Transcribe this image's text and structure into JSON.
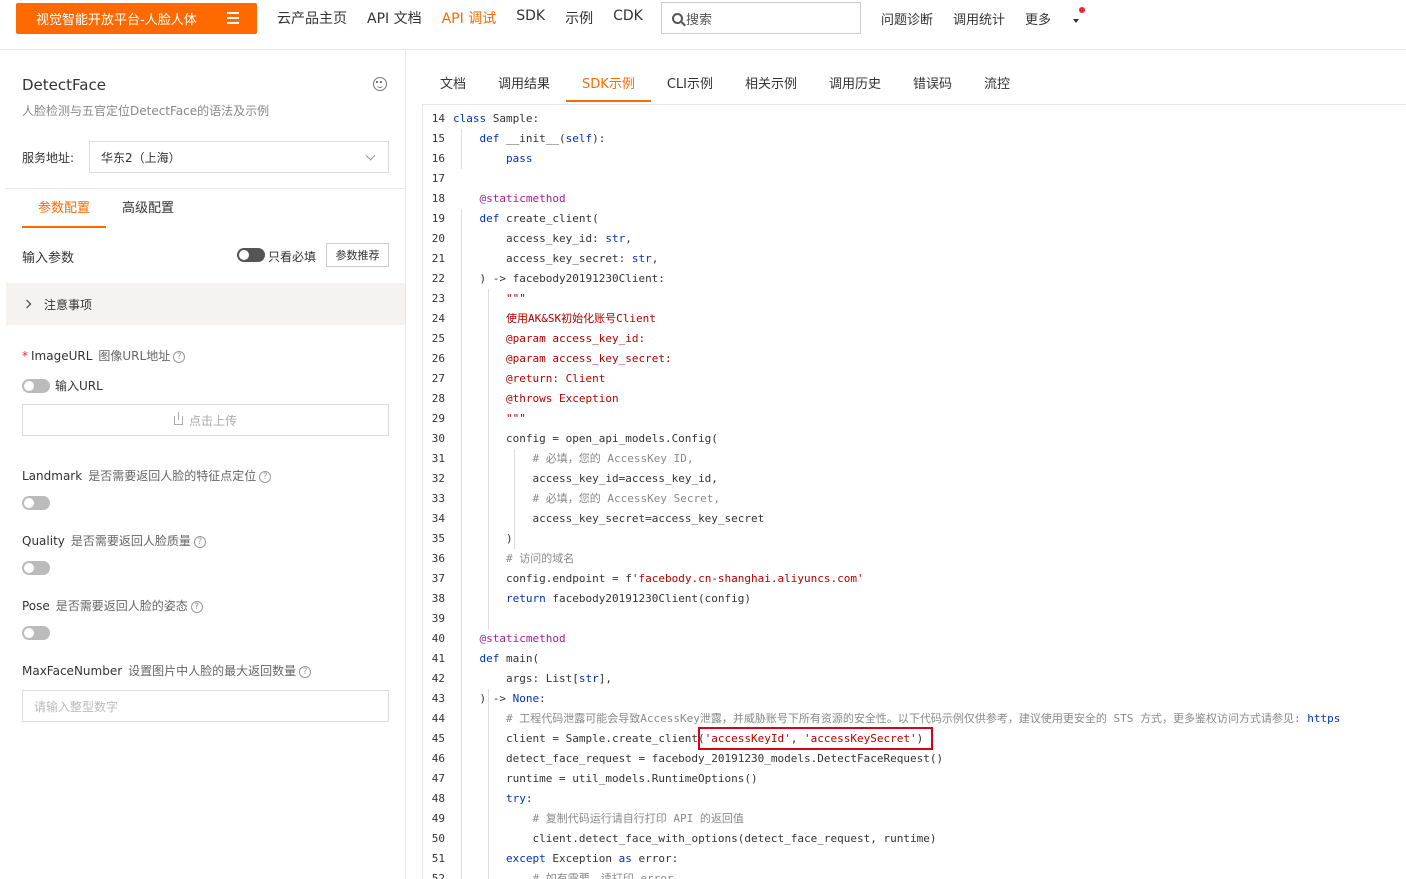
{
  "topbar": {
    "brand": "视觉智能开放平台-人脸人体",
    "nav": [
      "云产品主页",
      "API 文档",
      "API 调试",
      "SDK",
      "示例",
      "CDK"
    ],
    "nav_active": 2,
    "search_placeholder": "搜索",
    "right_links": [
      "问题诊断",
      "调用统计"
    ],
    "more": "更多"
  },
  "left": {
    "api_name": "DetectFace",
    "api_desc": "人脸检测与五官定位DetectFace的语法及示例",
    "service_label": "服务地址:",
    "service_value": "华东2（上海）",
    "tabs": [
      "参数配置",
      "高级配置"
    ],
    "input_params_label": "输入参数",
    "required_only_label": "只看必填",
    "recommend_button": "参数推荐",
    "notice": "注意事项",
    "image_url": {
      "name": "ImageURL",
      "desc": "图像URL地址",
      "toggle_label": "输入URL",
      "upload": "点击上传"
    },
    "landmark": {
      "name": "Landmark",
      "desc": "是否需要返回人脸的特征点定位"
    },
    "quality": {
      "name": "Quality",
      "desc": "是否需要返回人脸质量"
    },
    "pose": {
      "name": "Pose",
      "desc": "是否需要返回人脸的姿态"
    },
    "max_face": {
      "name": "MaxFaceNumber",
      "desc": "设置图片中人脸的最大返回数量",
      "placeholder": "请输入整型数字"
    }
  },
  "right": {
    "tabs": [
      "文档",
      "调用结果",
      "SDK示例",
      "CLI示例",
      "相关示例",
      "调用历史",
      "错误码",
      "流控"
    ],
    "active_tab": 2,
    "code_lines": [
      {
        "n": "14",
        "indent": 0,
        "parts": [
          [
            "kw",
            "class "
          ],
          [
            "txt",
            "Sample:"
          ]
        ]
      },
      {
        "n": "15",
        "indent": 1,
        "parts": [
          [
            "kw",
            "def "
          ],
          [
            "txt",
            "__init__("
          ],
          [
            "kw",
            "self"
          ],
          [
            "txt",
            "):"
          ]
        ]
      },
      {
        "n": "16",
        "indent": 2,
        "parts": [
          [
            "kw",
            "pass"
          ]
        ]
      },
      {
        "n": "17",
        "indent": 0,
        "parts": []
      },
      {
        "n": "18",
        "indent": 1,
        "parts": [
          [
            "dec",
            "@staticmethod"
          ]
        ]
      },
      {
        "n": "19",
        "indent": 1,
        "parts": [
          [
            "kw",
            "def "
          ],
          [
            "txt",
            "create_client("
          ]
        ]
      },
      {
        "n": "20",
        "indent": 2,
        "parts": [
          [
            "txt",
            "access_key_id: "
          ],
          [
            "kw",
            "str"
          ],
          [
            "txt",
            ","
          ]
        ]
      },
      {
        "n": "21",
        "indent": 2,
        "parts": [
          [
            "txt",
            "access_key_secret: "
          ],
          [
            "kw",
            "str"
          ],
          [
            "txt",
            ","
          ]
        ]
      },
      {
        "n": "22",
        "indent": 1,
        "parts": [
          [
            "txt",
            ") -> facebody20191230Client:"
          ]
        ]
      },
      {
        "n": "23",
        "indent": 2,
        "parts": [
          [
            "str",
            "\"\"\""
          ]
        ]
      },
      {
        "n": "24",
        "indent": 2,
        "parts": [
          [
            "str",
            "使用AK&SK初始化账号Client"
          ]
        ]
      },
      {
        "n": "25",
        "indent": 2,
        "parts": [
          [
            "str",
            "@param access_key_id:"
          ]
        ]
      },
      {
        "n": "26",
        "indent": 2,
        "parts": [
          [
            "str",
            "@param access_key_secret:"
          ]
        ]
      },
      {
        "n": "27",
        "indent": 2,
        "parts": [
          [
            "str",
            "@return: Client"
          ]
        ]
      },
      {
        "n": "28",
        "indent": 2,
        "parts": [
          [
            "str",
            "@throws Exception"
          ]
        ]
      },
      {
        "n": "29",
        "indent": 2,
        "parts": [
          [
            "str",
            "\"\"\""
          ]
        ]
      },
      {
        "n": "30",
        "indent": 2,
        "parts": [
          [
            "txt",
            "config = open_api_models.Config("
          ]
        ]
      },
      {
        "n": "31",
        "indent": 3,
        "parts": [
          [
            "cmt",
            "# 必填，您的 AccessKey ID,"
          ]
        ]
      },
      {
        "n": "32",
        "indent": 3,
        "parts": [
          [
            "txt",
            "access_key_id=access_key_id,"
          ]
        ]
      },
      {
        "n": "33",
        "indent": 3,
        "parts": [
          [
            "cmt",
            "# 必填，您的 AccessKey Secret,"
          ]
        ]
      },
      {
        "n": "34",
        "indent": 3,
        "parts": [
          [
            "txt",
            "access_key_secret=access_key_secret"
          ]
        ]
      },
      {
        "n": "35",
        "indent": 2,
        "parts": [
          [
            "txt",
            ")"
          ]
        ]
      },
      {
        "n": "36",
        "indent": 2,
        "parts": [
          [
            "cmt",
            "# 访问的域名"
          ]
        ]
      },
      {
        "n": "37",
        "indent": 2,
        "parts": [
          [
            "txt",
            "config.endpoint = f"
          ],
          [
            "str",
            "'facebody.cn-shanghai.aliyuncs.com'"
          ]
        ]
      },
      {
        "n": "38",
        "indent": 2,
        "parts": [
          [
            "kw",
            "return "
          ],
          [
            "txt",
            "facebody20191230Client(config)"
          ]
        ]
      },
      {
        "n": "39",
        "indent": 0,
        "parts": []
      },
      {
        "n": "40",
        "indent": 1,
        "parts": [
          [
            "dec",
            "@staticmethod"
          ]
        ]
      },
      {
        "n": "41",
        "indent": 1,
        "parts": [
          [
            "kw",
            "def "
          ],
          [
            "txt",
            "main("
          ]
        ]
      },
      {
        "n": "42",
        "indent": 2,
        "parts": [
          [
            "txt",
            "args: List["
          ],
          [
            "kw",
            "str"
          ],
          [
            "txt",
            "],"
          ]
        ]
      },
      {
        "n": "43",
        "indent": 1,
        "parts": [
          [
            "txt",
            ") -> "
          ],
          [
            "kw",
            "None"
          ],
          [
            "txt",
            ":"
          ]
        ]
      },
      {
        "n": "44",
        "indent": 2,
        "parts": [
          [
            "cmt",
            "# 工程代码泄露可能会导致AccessKey泄露，并威胁账号下所有资源的安全性。以下代码示例仅供参考，建议使用更安全的 STS 方式，更多鉴权访问方式请参见: "
          ],
          [
            "kw",
            "https"
          ]
        ]
      },
      {
        "n": "45",
        "indent": 2,
        "parts": [
          [
            "txt",
            "client = Sample.create_client("
          ],
          [
            "str",
            "'accessKeyId'"
          ],
          [
            "txt",
            ", "
          ],
          [
            "str",
            "'accessKeySecret'"
          ],
          [
            "txt",
            ")"
          ]
        ]
      },
      {
        "n": "46",
        "indent": 2,
        "parts": [
          [
            "txt",
            "detect_face_request = facebody_20191230_models.DetectFaceRequest()"
          ]
        ]
      },
      {
        "n": "47",
        "indent": 2,
        "parts": [
          [
            "txt",
            "runtime = util_models.RuntimeOptions()"
          ]
        ]
      },
      {
        "n": "48",
        "indent": 2,
        "parts": [
          [
            "kw",
            "try"
          ],
          [
            "txt",
            ":"
          ]
        ]
      },
      {
        "n": "49",
        "indent": 3,
        "parts": [
          [
            "cmt",
            "# 复制代码运行请自行打印 API 的返回值"
          ]
        ]
      },
      {
        "n": "50",
        "indent": 3,
        "parts": [
          [
            "txt",
            "client.detect_face_with_options(detect_face_request, runtime)"
          ]
        ]
      },
      {
        "n": "51",
        "indent": 2,
        "parts": [
          [
            "kw",
            "except "
          ],
          [
            "txt",
            "Exception "
          ],
          [
            "kw",
            "as "
          ],
          [
            "txt",
            "error:"
          ]
        ]
      },
      {
        "n": "52",
        "indent": 3,
        "parts": [
          [
            "cmt",
            "# 如有需要，请打印 error"
          ]
        ]
      }
    ]
  }
}
